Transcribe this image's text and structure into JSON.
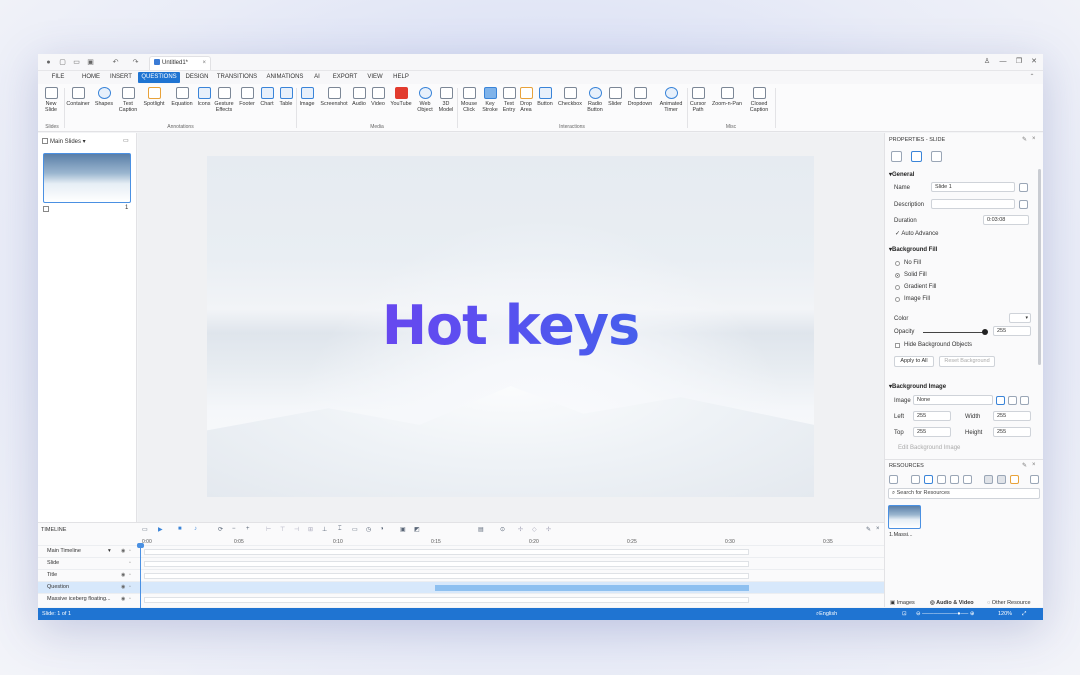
{
  "titlebar": {
    "doc_title": "Untitled1*"
  },
  "menu": [
    {
      "label": "FILE"
    },
    {
      "label": "HOME"
    },
    {
      "label": "INSERT"
    },
    {
      "label": "QUESTIONS"
    },
    {
      "label": "DESIGN"
    },
    {
      "label": "TRANSITIONS"
    },
    {
      "label": "ANIMATIONS"
    },
    {
      "label": "AI"
    },
    {
      "label": "EXPORT"
    },
    {
      "label": "VIEW"
    },
    {
      "label": "HELP"
    }
  ],
  "ribbon": {
    "buttons": [
      {
        "label": "New Slide"
      },
      {
        "label": "Container"
      },
      {
        "label": "Shapes"
      },
      {
        "label": "Text Caption"
      },
      {
        "label": "Spotlight"
      },
      {
        "label": "Equation"
      },
      {
        "label": "Icons"
      },
      {
        "label": "Gesture Effects"
      },
      {
        "label": "Footer"
      },
      {
        "label": "Chart"
      },
      {
        "label": "Table"
      },
      {
        "label": "Image"
      },
      {
        "label": "Screenshot"
      },
      {
        "label": "Audio"
      },
      {
        "label": "Video"
      },
      {
        "label": "YouTube"
      },
      {
        "label": "Web Object"
      },
      {
        "label": "3D Model"
      },
      {
        "label": "Mouse Click"
      },
      {
        "label": "Key Stroke"
      },
      {
        "label": "Text Entry"
      },
      {
        "label": "Drop Area"
      },
      {
        "label": "Button"
      },
      {
        "label": "Checkbox"
      },
      {
        "label": "Radio Button"
      },
      {
        "label": "Slider"
      },
      {
        "label": "Dropdown"
      },
      {
        "label": "Animated Timer"
      },
      {
        "label": "Cursor Path"
      },
      {
        "label": "Zoom-n-Pan"
      },
      {
        "label": "Closed Caption"
      }
    ],
    "groups": [
      {
        "label": "Slides"
      },
      {
        "label": "Annotations"
      },
      {
        "label": "Media"
      },
      {
        "label": "Interactions"
      },
      {
        "label": "Misc"
      }
    ]
  },
  "left_panel": {
    "dropdown": "Main Slides",
    "slide_number": "1"
  },
  "slide": {
    "headline": "Hot keys"
  },
  "properties": {
    "title": "PROPERTIES - SLIDE",
    "general": {
      "heading": "General",
      "name_label": "Name",
      "name_value": "Slide 1",
      "description_label": "Description",
      "description_value": "",
      "duration_label": "Duration",
      "duration_value": "0:03:08",
      "auto_advance_label": "Auto Advance"
    },
    "background_fill": {
      "heading": "Background Fill",
      "options": [
        {
          "label": "No Fill",
          "selected": false
        },
        {
          "label": "Solid Fill",
          "selected": true
        },
        {
          "label": "Gradient Fill",
          "selected": false
        },
        {
          "label": "Image Fill",
          "selected": false
        }
      ],
      "color_label": "Color",
      "color_value": "#ffffff",
      "opacity_label": "Opacity",
      "opacity_value": "255",
      "opacity_fraction": 1.0,
      "hide_bg_label": "Hide Background Objects",
      "apply_all_label": "Apply to All",
      "reset_label": "Reset Background"
    },
    "background_image": {
      "heading": "Background Image",
      "image_label": "Image",
      "image_value": "None",
      "left_label": "Left",
      "left_value": "255",
      "top_label": "Top",
      "top_value": "255",
      "width_label": "Width",
      "width_value": "255",
      "height_label": "Height",
      "height_value": "255",
      "edit_label": "Edit Background Image"
    }
  },
  "resources": {
    "title": "RESOURCES",
    "search_placeholder": "Search for Resources",
    "item_label": "1.Massi...",
    "tabs": [
      {
        "label": "Images"
      },
      {
        "label": "Audio & Video"
      },
      {
        "label": "Other Resource"
      }
    ]
  },
  "timeline": {
    "title": "TIMELINE",
    "ticks": [
      "0:00",
      "0:05",
      "0:10",
      "0:15",
      "0:20",
      "0:25",
      "0:30",
      "0:35"
    ],
    "rows": [
      {
        "label": "Main Timeline"
      },
      {
        "label": "Slide"
      },
      {
        "label": "Title"
      },
      {
        "label": "Question"
      },
      {
        "label": "Massive iceberg floating..."
      }
    ]
  },
  "status": {
    "slide_info": "Slide: 1 of 1",
    "language": "English (United States)",
    "zoom": "120%"
  },
  "colors": {
    "accent": "#1f74d2",
    "selection": "#d7e8fb",
    "headline_start": "#7c3aed",
    "headline_end": "#2f6fe8"
  }
}
